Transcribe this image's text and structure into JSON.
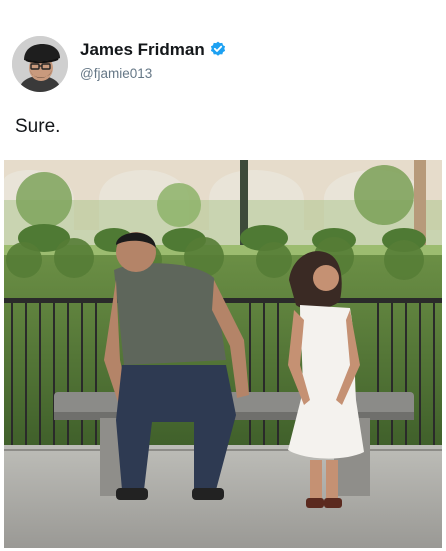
{
  "author": {
    "name": "James Fridman",
    "handle": "@fjamie013",
    "verified": true,
    "avatar_icon": "avatar-photo"
  },
  "tweet": {
    "text": "Sure."
  },
  "media": {
    "type": "photo",
    "icon": "photo-image"
  },
  "colors": {
    "name": "#14171a",
    "handle": "#657786",
    "verified": "#1da1f2"
  }
}
